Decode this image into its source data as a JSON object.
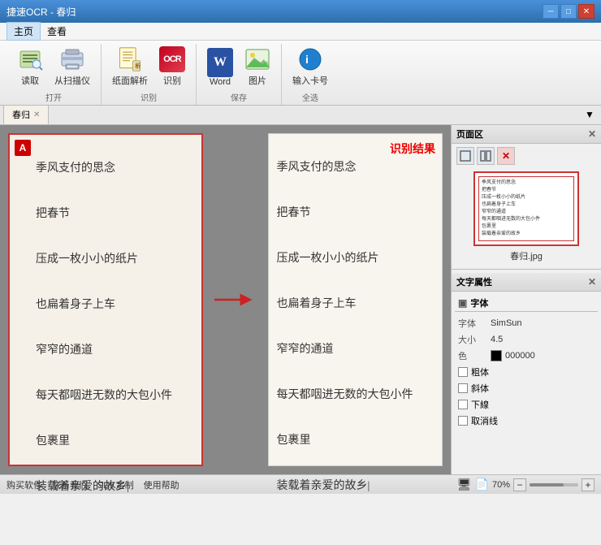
{
  "titleBar": {
    "title": "捷速OCR - 春归",
    "minBtn": "─",
    "maxBtn": "□",
    "closeBtn": "✕"
  },
  "menuBar": {
    "items": [
      "主页",
      "查看"
    ]
  },
  "ribbon": {
    "groups": [
      {
        "label": "打开",
        "buttons": [
          {
            "id": "read",
            "label": "读取",
            "icon": "read"
          },
          {
            "id": "scan",
            "label": "从扫描仪",
            "icon": "scan"
          }
        ]
      },
      {
        "label": "识别",
        "buttons": [
          {
            "id": "paper",
            "label": "纸面解析",
            "icon": "paper"
          },
          {
            "id": "ocr",
            "label": "识别",
            "icon": "ocr"
          }
        ]
      },
      {
        "label": "保存",
        "buttons": [
          {
            "id": "word",
            "label": "Word",
            "icon": "word"
          },
          {
            "id": "image",
            "label": "图片",
            "icon": "image"
          }
        ]
      },
      {
        "label": "全选",
        "buttons": [
          {
            "id": "card",
            "label": "输入卡号",
            "icon": "card"
          }
        ]
      }
    ]
  },
  "tab": {
    "name": "春归",
    "closeIcon": "✕",
    "dropdownIcon": "▼"
  },
  "docLeft": {
    "lines": [
      "季风支付的思念",
      "",
      "把春节",
      "",
      "压成一枚小小的纸片",
      "",
      "也扁着身子上车",
      "",
      "窄窄的通道",
      "",
      "每天都咽进无数的大包小件",
      "",
      "包裹里",
      "",
      "装载着亲爱的故乡|"
    ]
  },
  "docRight": {
    "ocrLabel": "识别结果",
    "lines": [
      "季风支付的思念",
      "",
      "把春节",
      "",
      "压成一枚小小的纸片",
      "",
      "也扁着身子上车",
      "",
      "窄窄的通道",
      "",
      "每天都咽进无数的大包小件",
      "",
      "包裹里",
      "",
      "装载着亲爱的故乡|"
    ]
  },
  "pageArea": {
    "title": "页面区",
    "tools": [
      "□",
      "□",
      "✕"
    ],
    "thumbnailLines": [
      "季风支付的思念",
      "把春节",
      "压成一枚小小的纸片",
      "也扁着身子上车",
      "窄窄的通道",
      "每天都咽进无数的大包小件",
      "包裹里",
      "装载着亲爱的故乡"
    ],
    "filename": "春归.jpg"
  },
  "textProps": {
    "title": "文字属性",
    "fontSection": "字体",
    "fontFace": {
      "label": "字体",
      "value": "SimSun"
    },
    "fontSize": {
      "label": "大小",
      "value": "4.5"
    },
    "fontColor": {
      "label": "色",
      "colorHex": "#000000",
      "value": "000000"
    },
    "checkboxes": [
      {
        "label": "粗体",
        "checked": false
      },
      {
        "label": "斜体",
        "checked": false
      },
      {
        "label": "下線",
        "checked": false
      },
      {
        "label": "取消线",
        "checked": false
      }
    ]
  },
  "statusBar": {
    "links": [
      "购买软件",
      "联系我们",
      "SDK定制",
      "使用帮助"
    ],
    "icons": [
      "computer",
      "doc"
    ],
    "zoom": "70%",
    "zoomMinus": "−",
    "zoomPlus": "+"
  }
}
